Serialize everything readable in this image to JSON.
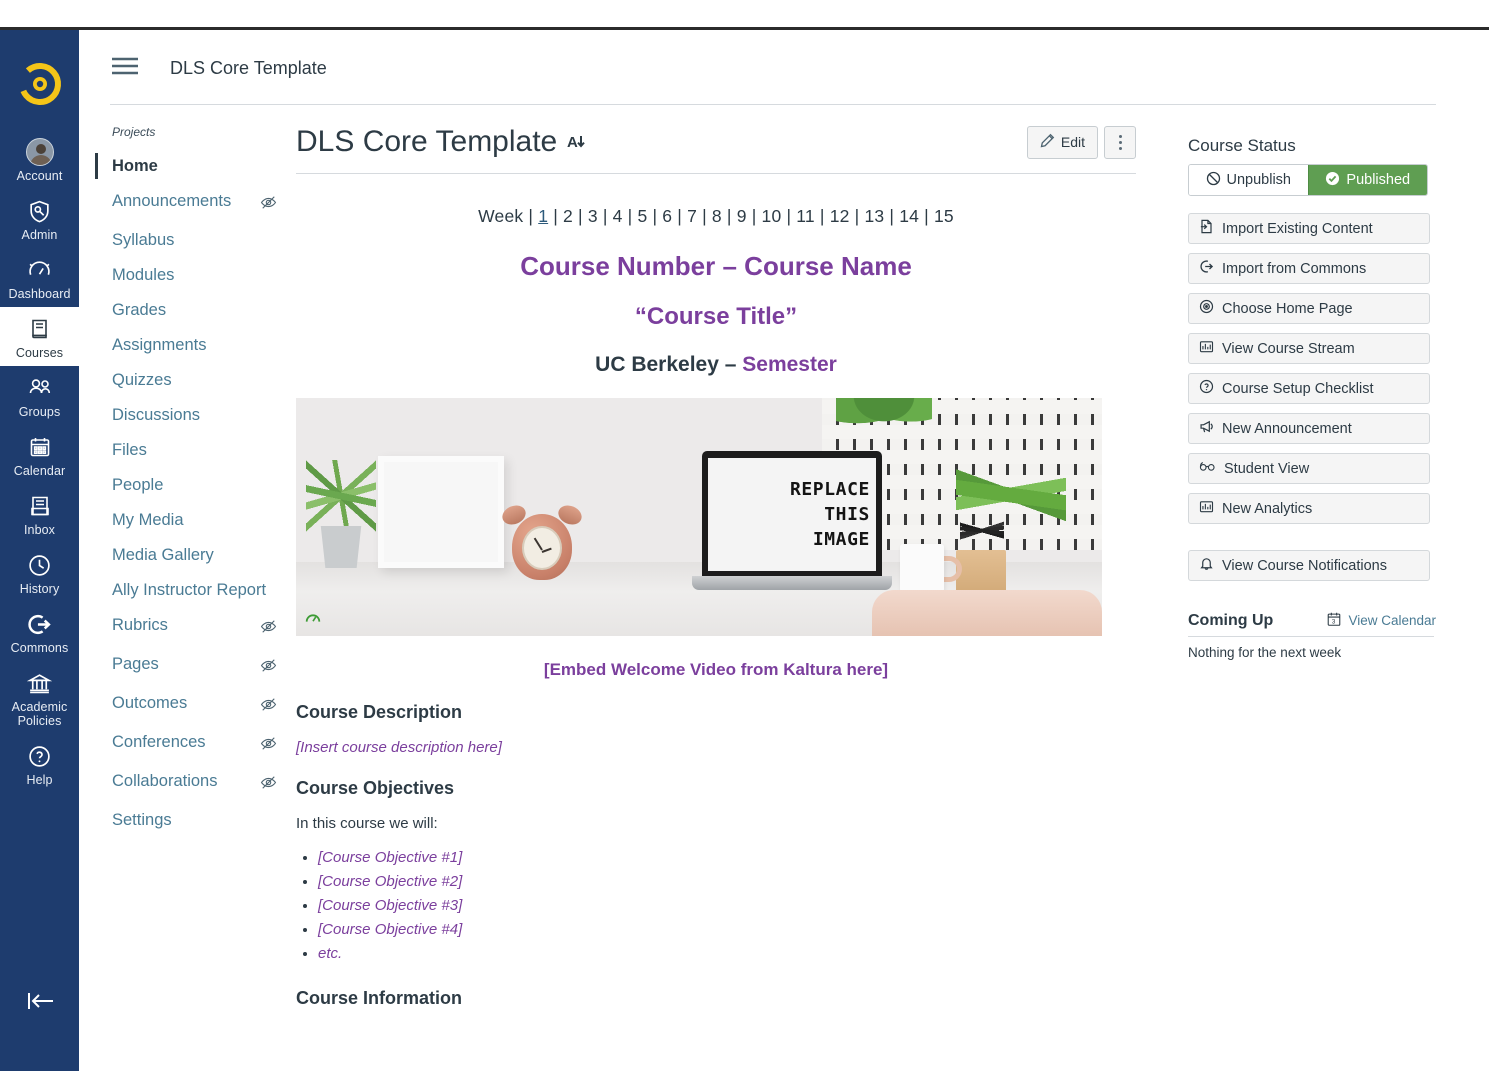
{
  "global_nav": {
    "logo_name": "canvas-logo",
    "items": [
      {
        "label": "Account",
        "icon": "avatar-icon"
      },
      {
        "label": "Admin",
        "icon": "shield-wrench-icon"
      },
      {
        "label": "Dashboard",
        "icon": "dashboard-gauge-icon"
      },
      {
        "label": "Courses",
        "icon": "book-icon",
        "active": true
      },
      {
        "label": "Groups",
        "icon": "people-group-icon"
      },
      {
        "label": "Calendar",
        "icon": "calendar-icon"
      },
      {
        "label": "Inbox",
        "icon": "inbox-tray-icon"
      },
      {
        "label": "History",
        "icon": "clock-icon"
      },
      {
        "label": "Commons",
        "icon": "arrow-out-circle-icon"
      },
      {
        "label": "Academic Policies",
        "icon": "bank-columns-icon"
      },
      {
        "label": "Help",
        "icon": "question-circle-icon"
      }
    ],
    "collapse_icon": "collapse-arrow-left-icon"
  },
  "topbar": {
    "menu_icon": "hamburger-menu-icon",
    "breadcrumb": "DLS Core Template"
  },
  "course_nav": {
    "section_label": "Projects",
    "items": [
      {
        "label": "Home",
        "active": true,
        "hidden": false
      },
      {
        "label": "Announcements",
        "active": false,
        "hidden": true
      },
      {
        "label": "Syllabus",
        "active": false,
        "hidden": false
      },
      {
        "label": "Modules",
        "active": false,
        "hidden": false
      },
      {
        "label": "Grades",
        "active": false,
        "hidden": false
      },
      {
        "label": "Assignments",
        "active": false,
        "hidden": false
      },
      {
        "label": "Quizzes",
        "active": false,
        "hidden": false
      },
      {
        "label": "Discussions",
        "active": false,
        "hidden": false
      },
      {
        "label": "Files",
        "active": false,
        "hidden": false
      },
      {
        "label": "People",
        "active": false,
        "hidden": false
      },
      {
        "label": "My Media",
        "active": false,
        "hidden": false
      },
      {
        "label": "Media Gallery",
        "active": false,
        "hidden": false
      },
      {
        "label": "Ally Instructor Report",
        "active": false,
        "hidden": false
      },
      {
        "label": "Rubrics",
        "active": false,
        "hidden": true
      },
      {
        "label": "Pages",
        "active": false,
        "hidden": true
      },
      {
        "label": "Outcomes",
        "active": false,
        "hidden": true
      },
      {
        "label": "Conferences",
        "active": false,
        "hidden": true
      },
      {
        "label": "Collaborations",
        "active": false,
        "hidden": true
      },
      {
        "label": "Settings",
        "active": false,
        "hidden": false
      }
    ]
  },
  "page_header": {
    "title": "DLS Core Template",
    "ally_indicator_icon": "ally-score-a-down-icon",
    "edit_label": "Edit",
    "edit_icon": "pencil-icon",
    "kebab_icon": "more-options-icon"
  },
  "content": {
    "week_label": "Week",
    "week_separator": "|",
    "weeks": [
      "1",
      "2",
      "3",
      "4",
      "5",
      "6",
      "7",
      "8",
      "9",
      "10",
      "11",
      "12",
      "13",
      "14",
      "15"
    ],
    "active_week": "1",
    "heading_1": "Course Number – Course Name",
    "heading_2": "“Course Title”",
    "heading_3_plain": "UC Berkeley – ",
    "heading_3_accent": "Semester",
    "hero_image_text": [
      "REPLACE",
      "THIS",
      "IMAGE"
    ],
    "hero_ally_icon": "ally-gauge-green-icon",
    "hero_caption": "[Embed Welcome Video from Kaltura here]",
    "description_heading": "Course Description",
    "description_placeholder": "[Insert course description here]",
    "objectives_heading": "Course Objectives",
    "objectives_intro": "In this course we will:",
    "objectives": [
      "[Course Objective #1]",
      "[Course Objective #2]",
      "[Course Objective #3]",
      "[Course Objective #4]",
      "etc."
    ],
    "information_heading": "Course Information"
  },
  "right_rail": {
    "status_heading": "Course Status",
    "unpublish_label": "Unpublish",
    "unpublish_icon": "no-circle-icon",
    "published_label": "Published",
    "published_icon": "check-circle-icon",
    "published_color": "#5f9e52",
    "buttons": [
      {
        "label": "Import Existing Content",
        "icon": "import-arrow-icon"
      },
      {
        "label": "Import from Commons",
        "icon": "commons-icon"
      },
      {
        "label": "Choose Home Page",
        "icon": "target-circle-icon"
      },
      {
        "label": "View Course Stream",
        "icon": "chart-bars-icon"
      },
      {
        "label": "Course Setup Checklist",
        "icon": "question-circle-icon"
      },
      {
        "label": "New Announcement",
        "icon": "megaphone-icon"
      },
      {
        "label": "Student View",
        "icon": "eyeglasses-icon"
      },
      {
        "label": "New Analytics",
        "icon": "chart-bars-icon"
      }
    ],
    "notifications_label": "View Course Notifications",
    "notifications_icon": "bell-icon",
    "coming_up_title": "Coming Up",
    "view_calendar_label": "View Calendar",
    "view_calendar_icon": "calendar-icon",
    "coming_up_empty": "Nothing for the next week"
  },
  "colors": {
    "nav_navy": "#1e3c6e",
    "accent_purple": "#7b3f9d",
    "link_blue": "#4a7b94",
    "published_green": "#5f9e52",
    "text_dark": "#2d3b45"
  }
}
